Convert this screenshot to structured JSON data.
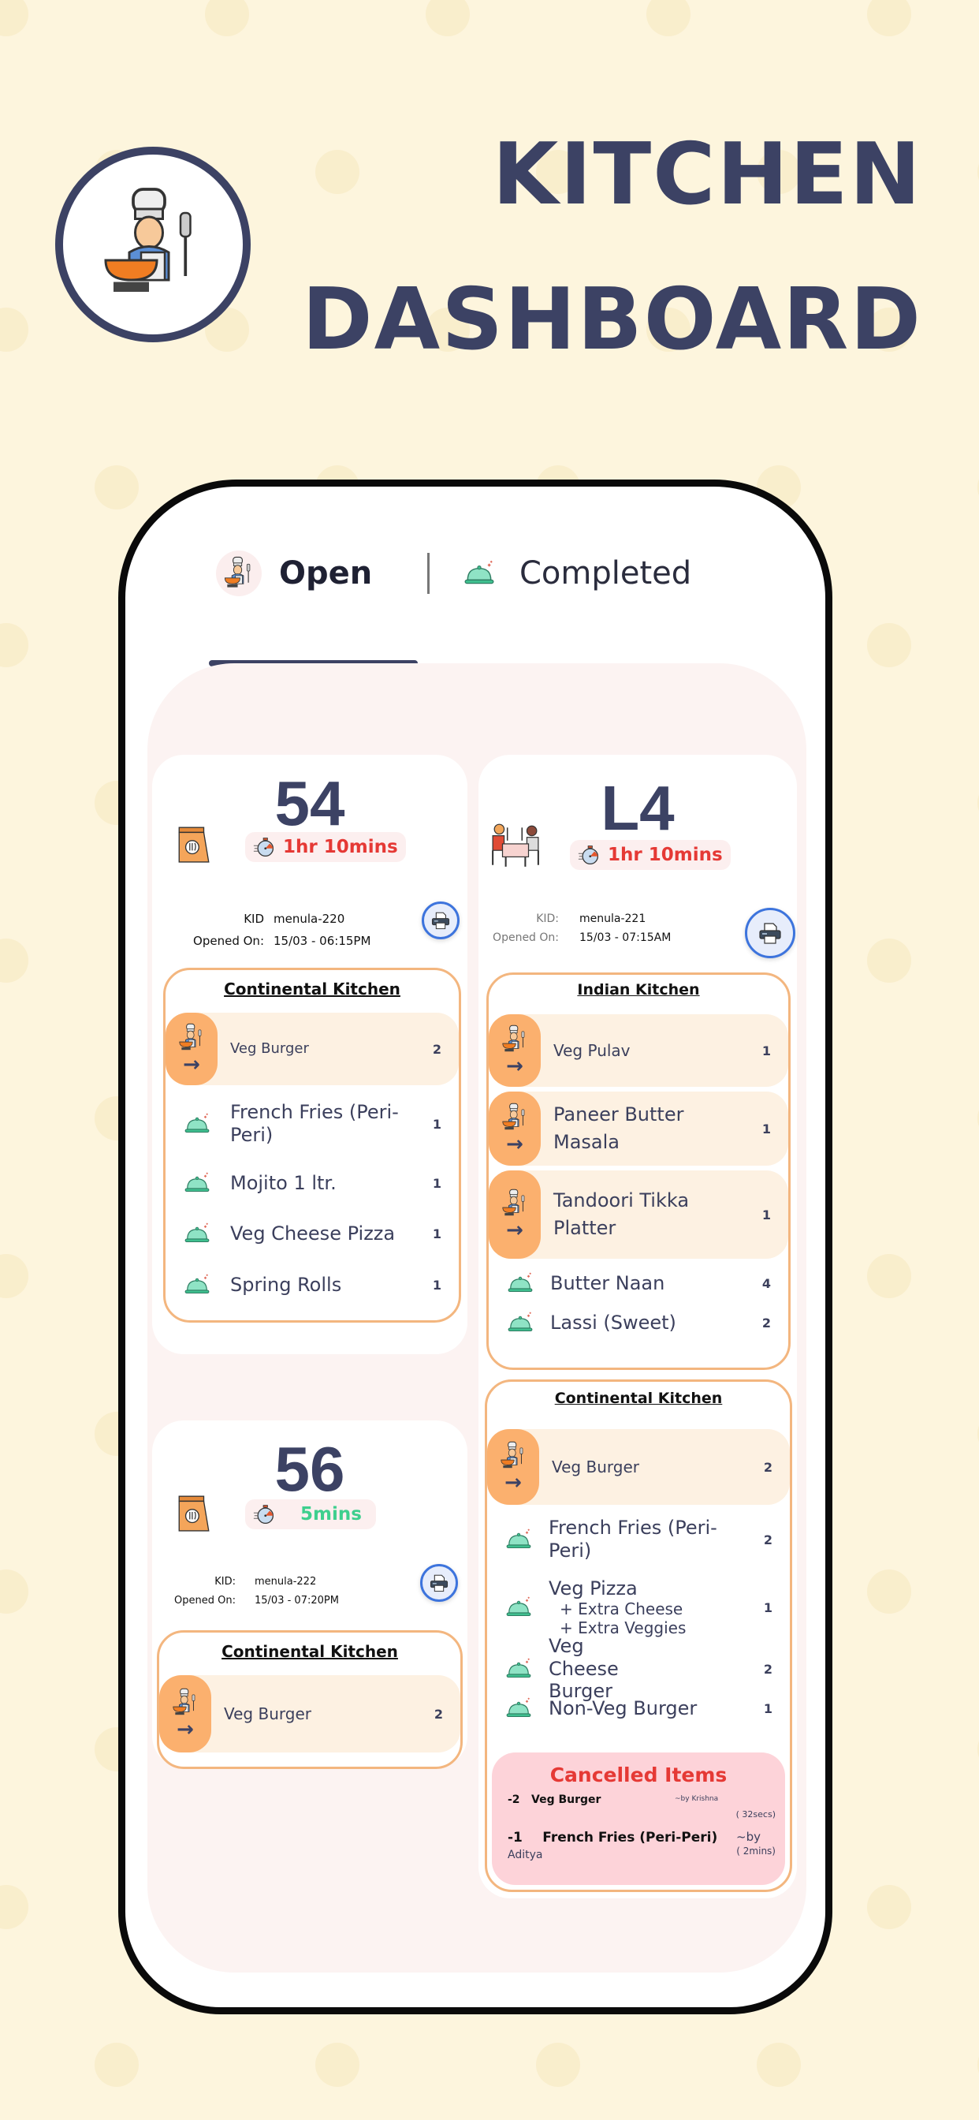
{
  "header": {
    "title_line1": "KITCHEN",
    "title_line2": "DASHBOARD",
    "logo_icon": "chef-cooking-icon"
  },
  "tabs": [
    {
      "label": "Open",
      "icon": "chef-icon",
      "active": true
    },
    {
      "label": "Completed",
      "icon": "cloche-icon",
      "active": false
    }
  ],
  "colors": {
    "accent": "#3c4264",
    "timer_overdue": "#e53935",
    "timer_ok": "#3ecf8e",
    "in_progress_tab": "#fbb06e",
    "kitchen_border": "#f3b67f",
    "cancelled_bg": "#fdd3d9",
    "print_button_border": "#3d74dd"
  },
  "orders": [
    {
      "number": "54",
      "type_icon": "takeaway-bag-icon",
      "timer": "1hr 10mins",
      "timer_status": "overdue",
      "kid_label": "KID",
      "kid": "menula-220",
      "opened_label": "Opened On:",
      "opened_on": "15/03 - 06:15PM",
      "kitchens": [
        {
          "name": "Continental Kitchen",
          "items": [
            {
              "name": "Veg Burger",
              "qty": "2",
              "status": "in-progress"
            },
            {
              "name": "French Fries (Peri-Peri)",
              "qty": "1",
              "status": "ready"
            },
            {
              "name": "Mojito 1 ltr.",
              "qty": "1",
              "status": "ready"
            },
            {
              "name": "Veg Cheese Pizza",
              "qty": "1",
              "status": "ready"
            },
            {
              "name": "Spring Rolls",
              "qty": "1",
              "status": "ready"
            }
          ]
        }
      ]
    },
    {
      "number": "L4",
      "type_icon": "dine-in-table-icon",
      "timer": "1hr 10mins",
      "timer_status": "overdue",
      "kid_label": "KID:",
      "kid": "menula-221",
      "opened_label": "Opened On:",
      "opened_on": "15/03 - 07:15AM",
      "kitchens": [
        {
          "name": "Indian Kitchen",
          "items": [
            {
              "name": "Veg Pulav",
              "qty": "1",
              "status": "in-progress"
            },
            {
              "name": "Paneer Butter Masala",
              "qty": "1",
              "status": "in-progress"
            },
            {
              "name": "Tandoori Tikka Platter",
              "qty": "1",
              "status": "in-progress"
            },
            {
              "name": "Butter Naan",
              "qty": "4",
              "status": "ready"
            },
            {
              "name": "Lassi (Sweet)",
              "qty": "2",
              "status": "ready"
            }
          ]
        },
        {
          "name": "Continental Kitchen",
          "items": [
            {
              "name": "Veg Burger",
              "qty": "2",
              "status": "in-progress"
            },
            {
              "name": "French Fries (Peri-Peri)",
              "qty": "2",
              "status": "ready"
            },
            {
              "name": "Veg Pizza",
              "qty": "1",
              "status": "ready",
              "addons": [
                "+ Extra Cheese",
                "+ Extra Veggies"
              ]
            },
            {
              "name": "Veg Cheese Burger",
              "qty": "2",
              "status": "ready"
            },
            {
              "name": "Non-Veg Burger",
              "qty": "1",
              "status": "ready"
            }
          ],
          "cancelled": {
            "title": "Cancelled Items",
            "items": [
              {
                "qty": "-2",
                "name": "Veg Burger",
                "by": "~by Krishna",
                "ago": "( 32secs)"
              },
              {
                "qty": "-1",
                "name": "French Fries (Peri-Peri)",
                "by": "~by",
                "by_name": "Aditya",
                "ago": "( 2mins)"
              }
            ]
          }
        }
      ]
    },
    {
      "number": "56",
      "type_icon": "takeaway-bag-icon",
      "timer": "5mins",
      "timer_status": "ok",
      "kid_label": "KID:",
      "kid": "menula-222",
      "opened_label": "Opened On:",
      "opened_on": "15/03 - 07:20PM",
      "kitchens": [
        {
          "name": "Continental Kitchen",
          "items": [
            {
              "name": "Veg Burger",
              "qty": "2",
              "status": "in-progress"
            }
          ]
        }
      ]
    }
  ]
}
